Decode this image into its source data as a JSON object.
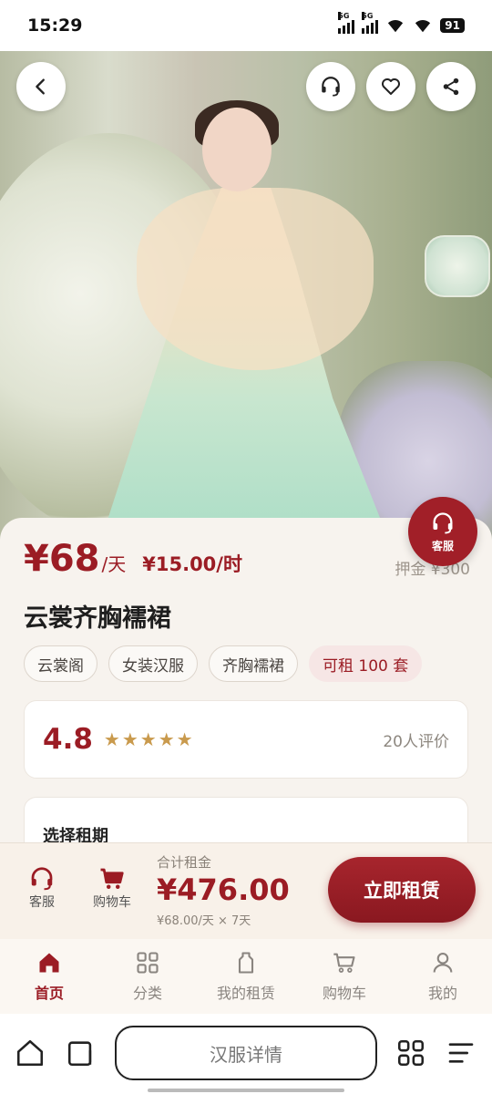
{
  "status_bar": {
    "time": "15:29",
    "signal1_tag": "5G",
    "signal2_tag": "5G",
    "battery": "91",
    "icons": [
      "signal-icon",
      "signal-icon",
      "wifi-icon",
      "wifi-icon",
      "battery-icon"
    ]
  },
  "hero": {
    "top_buttons": [
      "back-icon",
      "headset-icon",
      "heart-icon",
      "share-icon"
    ]
  },
  "customer_service_fab": {
    "label": "客服",
    "icon": "headset-icon"
  },
  "product": {
    "price": "¥68",
    "price_unit": "/天",
    "hourly_price": "¥15.00/时",
    "deposit": "押金 ¥300",
    "title": "云裳齐胸襦裙",
    "tags": [
      "云裳阁",
      "女装汉服",
      "齐胸襦裙"
    ],
    "availability": "可租 100 套"
  },
  "rating": {
    "score": "4.8",
    "stars": 5,
    "count": "20人评价"
  },
  "rental_period": {
    "title": "选择租期"
  },
  "action_bar": {
    "cs_label": "客服",
    "cart_label": "购物车",
    "total_label": "合计租金",
    "total_value": "¥476.00",
    "total_note": "¥68.00/天 × 7天",
    "rent_button": "立即租赁"
  },
  "tabs": [
    {
      "label": "首页",
      "icon": "home-icon",
      "active": true
    },
    {
      "label": "分类",
      "icon": "grid-icon",
      "active": false
    },
    {
      "label": "我的租赁",
      "icon": "garment-icon",
      "active": false
    },
    {
      "label": "购物车",
      "icon": "cart-icon",
      "active": false
    },
    {
      "label": "我的",
      "icon": "user-icon",
      "active": false
    }
  ],
  "browser": {
    "url_title": "汉服详情"
  },
  "colors": {
    "accent": "#9b1c24",
    "star": "#c99a4d",
    "background": "#f7f3ee"
  }
}
